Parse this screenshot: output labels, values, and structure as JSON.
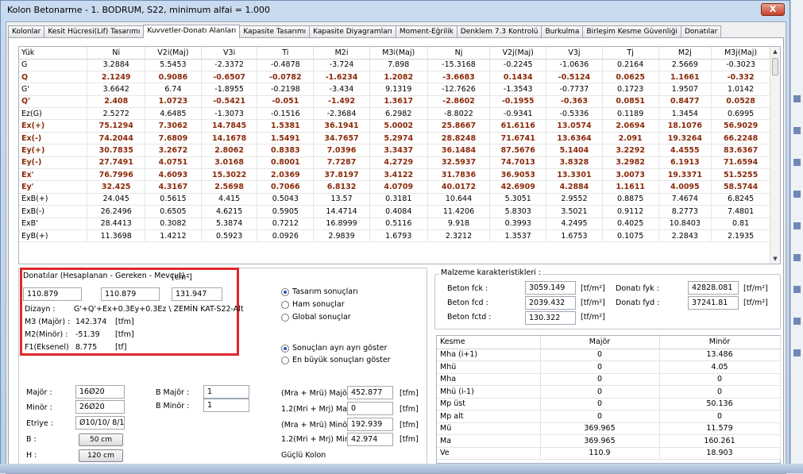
{
  "window": {
    "title": "Kolon Betonarme - 1. BODRUM, S22, minimum alfai = 1.000",
    "close_label": "X"
  },
  "tabs": [
    {
      "label": "Kolonlar"
    },
    {
      "label": "Kesit Hücresi(Lif) Tasarımı"
    },
    {
      "label": "Kuvvetler-Donatı Alanları"
    },
    {
      "label": "Kapasite Tasarımı"
    },
    {
      "label": "Kapasite Diyagramları"
    },
    {
      "label": "Moment-Eğrilik"
    },
    {
      "label": "Denklem 7.3 Kontrolü"
    },
    {
      "label": "Burkulma"
    },
    {
      "label": "Birleşim Kesme Güvenliği"
    },
    {
      "label": "Donatılar"
    }
  ],
  "active_tab": "Kuvvetler-Donatı Alanları",
  "forces": {
    "columns": [
      "Yük",
      "Ni",
      "V2i(Maj)",
      "V3i",
      "Ti",
      "M2i",
      "M3i(Maj)",
      "Nj",
      "V2j(Maj)",
      "V3j",
      "Tj",
      "M2j",
      "M3j(Maj)"
    ],
    "rows": [
      {
        "cells": [
          "G",
          "3.2884",
          "5.5453",
          "-2.3372",
          "-0.4878",
          "-3.724",
          "7.898",
          "-15.3168",
          "-0.2245",
          "-1.0636",
          "0.2164",
          "2.5669",
          "-0.3023"
        ],
        "bold": false
      },
      {
        "cells": [
          "Q",
          "2.1249",
          "0.9086",
          "-0.6507",
          "-0.0782",
          "-1.6234",
          "1.2082",
          "-3.6683",
          "0.1434",
          "-0.5124",
          "0.0625",
          "1.1661",
          "-0.332"
        ],
        "bold": true
      },
      {
        "cells": [
          "G'",
          "3.6642",
          "6.74",
          "-1.8955",
          "-0.2198",
          "-3.434",
          "9.1319",
          "-12.7626",
          "-1.3543",
          "-0.7737",
          "0.1723",
          "1.9507",
          "1.0142"
        ],
        "bold": false
      },
      {
        "cells": [
          "Q'",
          "2.408",
          "1.0723",
          "-0.5421",
          "-0.051",
          "-1.492",
          "1.3617",
          "-2.8602",
          "-0.1955",
          "-0.363",
          "0.0851",
          "0.8477",
          "0.0528"
        ],
        "bold": true
      },
      {
        "cells": [
          "Ez(G)",
          "2.5272",
          "4.6485",
          "-1.3073",
          "-0.1516",
          "-2.3684",
          "6.2982",
          "-8.8022",
          "-0.9341",
          "-0.5336",
          "0.1189",
          "1.3454",
          "0.6995"
        ],
        "bold": false
      },
      {
        "cells": [
          "Ex(+)",
          "75.1294",
          "7.3062",
          "14.7845",
          "1.5381",
          "36.1941",
          "5.0002",
          "25.8667",
          "61.6116",
          "13.0574",
          "2.0694",
          "18.1076",
          "56.9029"
        ],
        "bold": true
      },
      {
        "cells": [
          "Ex(-)",
          "74.2044",
          "7.6809",
          "14.1678",
          "1.5491",
          "34.7657",
          "5.2974",
          "28.8248",
          "71.6741",
          "13.6364",
          "2.091",
          "19.3264",
          "66.2248"
        ],
        "bold": true
      },
      {
        "cells": [
          "Ey(+)",
          "30.7835",
          "3.2672",
          "2.8062",
          "0.8383",
          "7.0396",
          "3.3437",
          "36.1484",
          "87.5676",
          "5.1404",
          "3.2292",
          "4.4555",
          "83.6367"
        ],
        "bold": true
      },
      {
        "cells": [
          "Ey(-)",
          "27.7491",
          "4.0751",
          "3.0168",
          "0.8001",
          "7.7287",
          "4.2729",
          "32.5937",
          "74.7013",
          "3.8328",
          "3.2982",
          "6.1913",
          "71.6594"
        ],
        "bold": true
      },
      {
        "cells": [
          "Ex'",
          "76.7996",
          "4.6093",
          "15.3022",
          "2.0369",
          "37.8197",
          "3.4122",
          "31.7836",
          "36.9053",
          "13.3301",
          "3.0073",
          "19.3371",
          "51.5255"
        ],
        "bold": true
      },
      {
        "cells": [
          "Ey'",
          "32.425",
          "4.3167",
          "2.5698",
          "0.7066",
          "6.8132",
          "4.0709",
          "40.0172",
          "42.6909",
          "4.2884",
          "1.1611",
          "4.0095",
          "58.5744"
        ],
        "bold": true
      },
      {
        "cells": [
          "ExB(+)",
          "24.045",
          "0.5615",
          "4.415",
          "0.5043",
          "13.57",
          "0.3181",
          "10.644",
          "5.3051",
          "2.9552",
          "0.8875",
          "7.4674",
          "6.8245"
        ],
        "bold": false
      },
      {
        "cells": [
          "ExB(-)",
          "26.2496",
          "0.6505",
          "4.6215",
          "0.5905",
          "14.4714",
          "0.4084",
          "11.4206",
          "5.8303",
          "3.5021",
          "0.9112",
          "8.2773",
          "7.4801"
        ],
        "bold": false
      },
      {
        "cells": [
          "ExB'",
          "28.4413",
          "0.3082",
          "5.3874",
          "0.7212",
          "16.8999",
          "0.5116",
          "9.918",
          "0.3993",
          "4.2495",
          "0.4025",
          "10.8403",
          "0.81"
        ],
        "bold": false
      },
      {
        "cells": [
          "EyB(+)",
          "11.3698",
          "1.4212",
          "0.5923",
          "0.0926",
          "2.9839",
          "1.6793",
          "2.3212",
          "1.3537",
          "1.6753",
          "0.1075",
          "2.2843",
          "2.1935"
        ],
        "bold": false
      }
    ]
  },
  "donatilar": {
    "label": "Donatılar (Hesaplanan - Gereken - Mevcut) :",
    "unit": "[cm²]",
    "values": [
      "110.879",
      "110.879",
      "131.947"
    ],
    "dizayn_label": "Dizayn :",
    "dizayn_value": "G'+Q'+Ex+0.3Ey+0.3Ez \\ ZEMİN KAT-S22-Alt",
    "m3_label": "M3 (Majör) :",
    "m3_value": "142.374",
    "m3_unit": "[tfm]",
    "m2_label": "M2(Minör) :",
    "m2_value": "-51.39",
    "m2_unit": "[tfm]",
    "f1_label": "F1(Eksenel)",
    "f1_value": "8.775",
    "f1_unit": "[tf]"
  },
  "result_options": {
    "group1": [
      {
        "label": "Tasarım sonuçları",
        "selected": true
      },
      {
        "label": "Ham sonuçlar",
        "selected": false
      },
      {
        "label": "Global sonuçlar",
        "selected": false
      }
    ],
    "group2": [
      {
        "label": "Sonuçları ayrı ayrı göster",
        "selected": true
      },
      {
        "label": "En büyük sonuçları göster",
        "selected": false
      }
    ]
  },
  "material": {
    "title": "Malzeme karakteristikleri :",
    "rows": [
      {
        "label": "Beton fck :",
        "value": "3059.149",
        "unit": "[tf/m²]"
      },
      {
        "label": "Beton fcd :",
        "value": "2039.432",
        "unit": "[tf/m²]"
      },
      {
        "label": "Beton fctd :",
        "value": "130.322",
        "unit": "[tf/m²]"
      }
    ],
    "fyk_label": "Donatı fyk :",
    "fyk_value": "42828.081",
    "fyk_unit": "[tf/m²]",
    "fyd_label": "Donatı fyd :",
    "fyd_value": "37241.81",
    "fyd_unit": "[tf/m²]"
  },
  "section": {
    "major_label": "Majör :",
    "major_value": "16Ø20",
    "minor_label": "Minör :",
    "minor_value": "26Ø20",
    "etriye_label": "Etriye :",
    "etriye_value": "Ø10/10/ 8/10",
    "b_label": "B :",
    "b_value": "50 cm",
    "h_label": "H :",
    "h_value": "120 cm",
    "b_major_label": "B Majör :",
    "b_major_value": "1",
    "b_minor_label": "B Minör :",
    "b_minor_value": "1"
  },
  "capacity": {
    "rows": [
      {
        "label": "(Mra + Mrü) Majör :",
        "value": "452.877",
        "unit": "[tfm]"
      },
      {
        "label": "1.2(Mri + Mrj) Majör",
        "value": "0",
        "unit": "[tfm]"
      },
      {
        "label": "(Mra + Mrü) Minör :",
        "value": "192.939",
        "unit": "[tfm]"
      },
      {
        "label": "1.2(Mri + Mrj) Minör",
        "value": "42.974",
        "unit": "[tfm]"
      }
    ],
    "strong_column": "Güçlü Kolon"
  },
  "kesme": {
    "columns": [
      "Kesme",
      "Majör",
      "Minör"
    ],
    "rows": [
      [
        "Mha (i+1)",
        "0",
        "13.486"
      ],
      [
        "Mhü",
        "0",
        "4.05"
      ],
      [
        "Mha",
        "0",
        "0"
      ],
      [
        "Mhü (i-1)",
        "0",
        "0"
      ],
      [
        "Mp üst",
        "0",
        "50.136"
      ],
      [
        "Mp alt",
        "0",
        "0"
      ],
      [
        "Mü",
        "369.965",
        "11.579"
      ],
      [
        "Ma",
        "369.965",
        "160.261"
      ],
      [
        "Ve",
        "110.9",
        "18.903"
      ]
    ]
  },
  "colors": {
    "bold_row": "#8b2a0a",
    "highlight_box": "#e0282b",
    "radio_dot": "#1b55c5"
  }
}
